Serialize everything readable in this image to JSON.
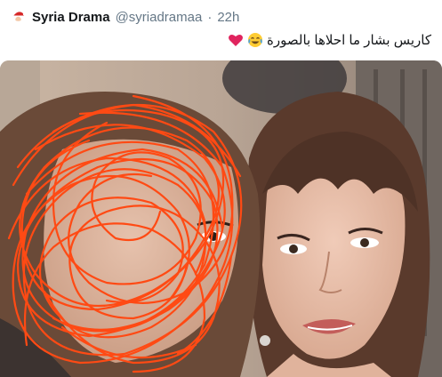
{
  "tweet": {
    "display_name": "Syria Drama",
    "handle": "@syriadramaa",
    "separator": "·",
    "time": "22h",
    "text": "كاريس بشار ما احلاها بالصورة",
    "emojis": [
      "tears-of-joy-emoji",
      "red-heart-emoji"
    ]
  },
  "icons": {
    "avatar": "santa-avatar-icon"
  },
  "photo": {
    "scribble_color": "#ff4a14",
    "left_face_obscured": true
  }
}
